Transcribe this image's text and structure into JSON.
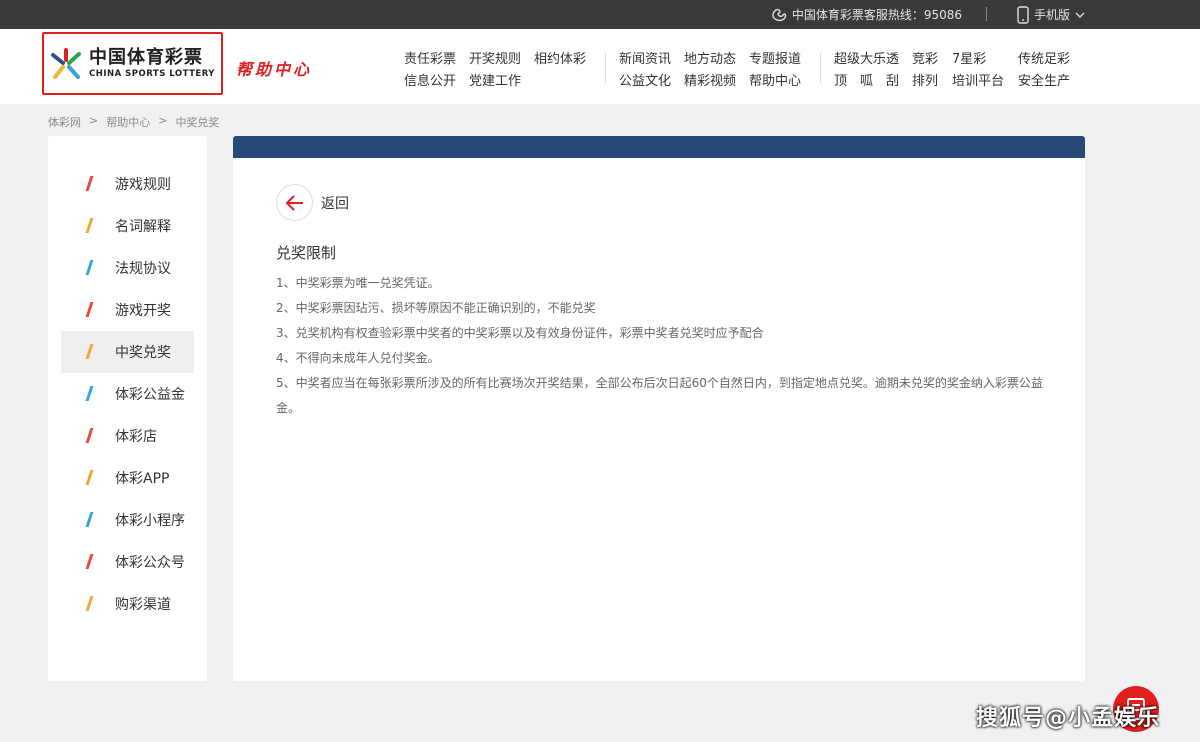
{
  "topbar": {
    "hotline": "中国体育彩票客服热线：95086",
    "mobile": "手机版"
  },
  "header": {
    "logo_cn": "中国体育彩票",
    "logo_en": "CHINA SPORTS LOTTERY",
    "help_title": "帮助中心",
    "nav_groups": [
      {
        "row1": [
          "责任彩票",
          "开奖规则",
          "相约体彩"
        ],
        "row2": [
          "信息公开",
          "党建工作"
        ]
      },
      {
        "row1": [
          "新闻资讯",
          "地方动态",
          "专题报道"
        ],
        "row2": [
          "公益文化",
          "精彩视频",
          "帮助中心"
        ]
      },
      {
        "row1": [
          "超级大乐透",
          "竞彩",
          "7星彩",
          "传统足彩"
        ],
        "row2": [
          "顶　呱　刮",
          "排列",
          "培训平台",
          "安全生产"
        ]
      }
    ]
  },
  "breadcrumb": [
    "体彩网",
    ">",
    "帮助中心",
    ">",
    "中奖兑奖"
  ],
  "sidebar": {
    "items": [
      {
        "label": "游戏规则",
        "color": "#e8473a"
      },
      {
        "label": "名词解释",
        "color": "#f2a53a"
      },
      {
        "label": "法规协议",
        "color": "#3aa0d8"
      },
      {
        "label": "游戏开奖",
        "color": "#e8473a"
      },
      {
        "label": "中奖兑奖",
        "color": "#f2a53a"
      },
      {
        "label": "体彩公益金",
        "color": "#3aa0d8"
      },
      {
        "label": "体彩店",
        "color": "#e8473a"
      },
      {
        "label": "体彩APP",
        "color": "#f2a53a"
      },
      {
        "label": "体彩小程序",
        "color": "#3aa0d8"
      },
      {
        "label": "体彩公众号",
        "color": "#e8473a"
      },
      {
        "label": "购彩渠道",
        "color": "#f2a53a"
      }
    ],
    "active_index": 4
  },
  "content": {
    "back_label": "返回",
    "title": "兑奖限制",
    "rules": [
      "1、中奖彩票为唯一兑奖凭证。",
      "2、中奖彩票因玷污、损坏等原因不能正确识别的，不能兑奖",
      "3、兑奖机构有权查验彩票中奖者的中奖彩票以及有效身份证件，彩票中奖者兑奖时应予配合",
      "4、不得向未成年人兑付奖金。",
      "5、中奖者应当在每张彩票所涉及的所有比赛场次开奖结果，全部公布后次日起60个自然日内，到指定地点兑奖。逾期未兑奖的奖金纳入彩票公益金。"
    ]
  },
  "watermark": "搜狐号@小孟娱乐",
  "colors": {
    "accent_red": "#e02020",
    "content_bar": "#264977",
    "topbar": "#3a3a3a"
  }
}
